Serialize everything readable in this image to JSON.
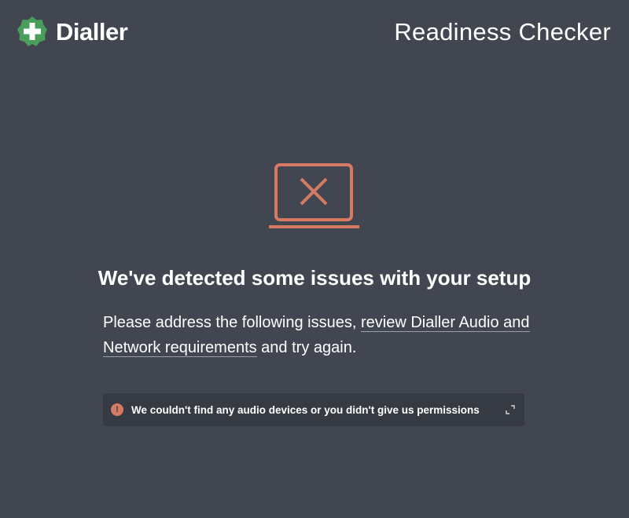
{
  "header": {
    "brand_name": "Dialler",
    "app_title": "Readiness Checker",
    "brand_color": "#4a9e5c",
    "logo_icon": "plus-badge-icon"
  },
  "status": {
    "illustration_icon": "laptop-error-icon",
    "accent_color": "#d77a64",
    "headline": "We've detected some issues with your setup",
    "description_prefix": "Please address the following issues, ",
    "description_link": "review Dialler Audio and Network requirements",
    "description_suffix": " and try again."
  },
  "issues": [
    {
      "icon": "error-icon",
      "icon_glyph": "!",
      "text": "We couldn't find any audio devices or you didn't give us permissions",
      "action_icon": "expand-icon"
    }
  ]
}
